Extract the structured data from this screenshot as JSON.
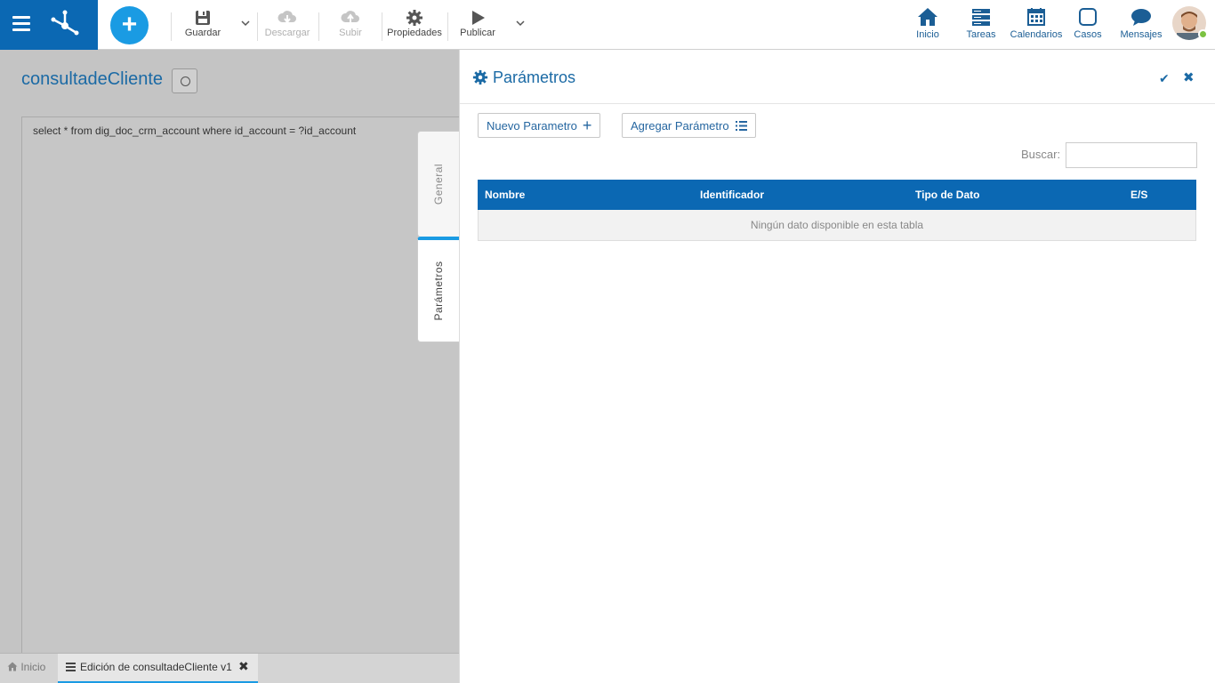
{
  "toolbar": {
    "guardar": "Guardar",
    "descargar": "Descargar",
    "subir": "Subir",
    "propiedades": "Propiedades",
    "publicar": "Publicar"
  },
  "nav": {
    "inicio": "Inicio",
    "tareas": "Tareas",
    "calendarios": "Calendarios",
    "casos": "Casos",
    "mensajes": "Mensajes"
  },
  "document": {
    "title": "consultadeCliente",
    "query": "select * from dig_doc_crm_account where id_account = ?id_account"
  },
  "vertical_tabs": {
    "general": "General",
    "parametros": "Parámetros"
  },
  "bottom_tabs": {
    "home": "Inicio",
    "edit": "Edición de consultadeCliente v1"
  },
  "panel": {
    "title": "Parámetros",
    "new_param": "Nuevo Parametro",
    "add_param": "Agregar Parámetro",
    "search_label": "Buscar:",
    "search_value": "",
    "columns": [
      "Nombre",
      "Identificador",
      "Tipo de Dato",
      "E/S"
    ],
    "empty_message": "Ningún dato disponible en esta tabla"
  },
  "colors": {
    "brand_blue": "#0b68b3",
    "accent": "#1a9be3"
  }
}
